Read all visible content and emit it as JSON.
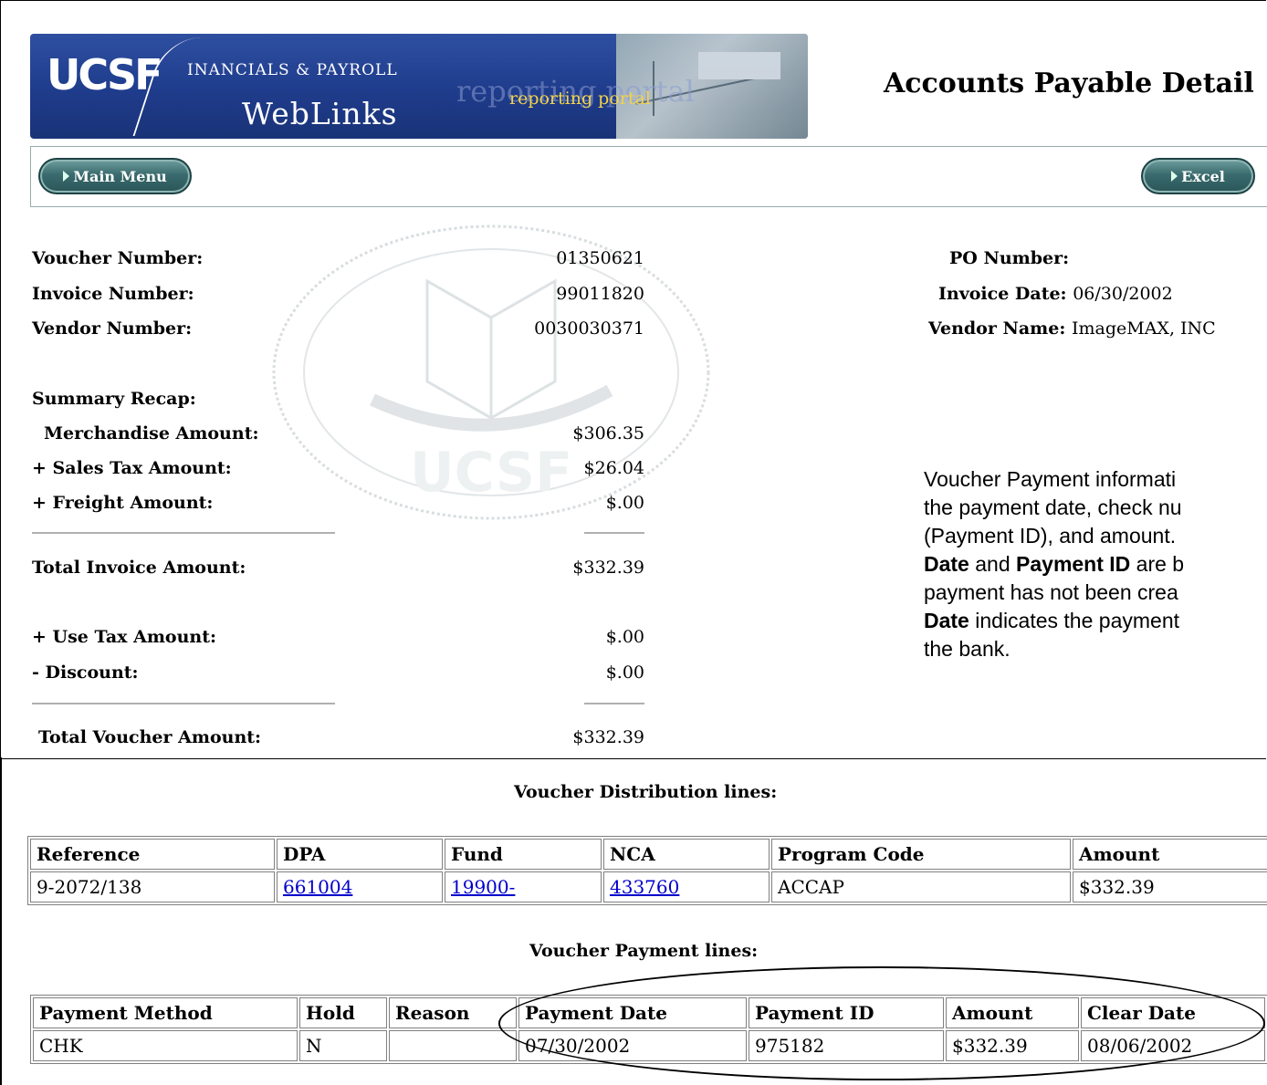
{
  "header": {
    "logo": "UCSF",
    "subtitle": "INANCIALS & PAYROLL",
    "product": "WebLinks",
    "portal": "reporting portal",
    "page_title": "Accounts Payable Detail"
  },
  "toolbar": {
    "main_menu_label": "Main Menu",
    "excel_label": "Excel"
  },
  "voucher": {
    "voucher_number_label": "Voucher Number:",
    "voucher_number": "01350621",
    "invoice_number_label": "Invoice Number:",
    "invoice_number": "99011820",
    "vendor_number_label": "Vendor Number:",
    "vendor_number": "0030030371",
    "po_number_label": "PO Number:",
    "po_number": "",
    "invoice_date_label": "Invoice Date:",
    "invoice_date": "06/30/2002",
    "vendor_name_label": "Vendor Name:",
    "vendor_name": "ImageMAX, INC"
  },
  "summary": {
    "title": "Summary Recap:",
    "merchandise_label": "Merchandise Amount:",
    "merchandise": "$306.35",
    "sales_tax_label": "+ Sales Tax Amount:",
    "sales_tax": "$26.04",
    "freight_label": "+ Freight Amount:",
    "freight": "$.00",
    "total_invoice_label": "Total Invoice Amount:",
    "total_invoice": "$332.39",
    "use_tax_label": "+ Use Tax Amount:",
    "use_tax": "$.00",
    "discount_label": "- Discount:",
    "discount": "$.00",
    "total_voucher_label": "Total Voucher Amount:",
    "total_voucher": "$332.39"
  },
  "note": {
    "line1": "Voucher Payment informati",
    "line2": "the payment date, check nu",
    "line3": "(Payment ID), and amount.",
    "line4_bold1": "Date",
    "line4_mid": " and ",
    "line4_bold2": "Payment ID",
    "line4_end": " are b",
    "line5": "payment has not been crea",
    "line6_bold": "Date",
    "line6_end": " indicates the payment",
    "line7": "the bank."
  },
  "distribution": {
    "title": "Voucher Distribution lines:",
    "headers": [
      "Reference",
      "DPA",
      "Fund",
      "NCA",
      "Program Code",
      "Amount"
    ],
    "rows": [
      [
        "9-2072/138",
        "661004",
        "19900-",
        "433760",
        "ACCAP",
        "$332.39"
      ]
    ]
  },
  "payment": {
    "title": "Voucher Payment lines:",
    "headers": [
      "Payment Method",
      "Hold",
      "Reason",
      "Payment Date",
      "Payment ID",
      "Amount",
      "Clear Date"
    ],
    "rows": [
      [
        "CHK",
        "N",
        "",
        "07/30/2002",
        "975182",
        "$332.39",
        "08/06/2002"
      ]
    ]
  }
}
